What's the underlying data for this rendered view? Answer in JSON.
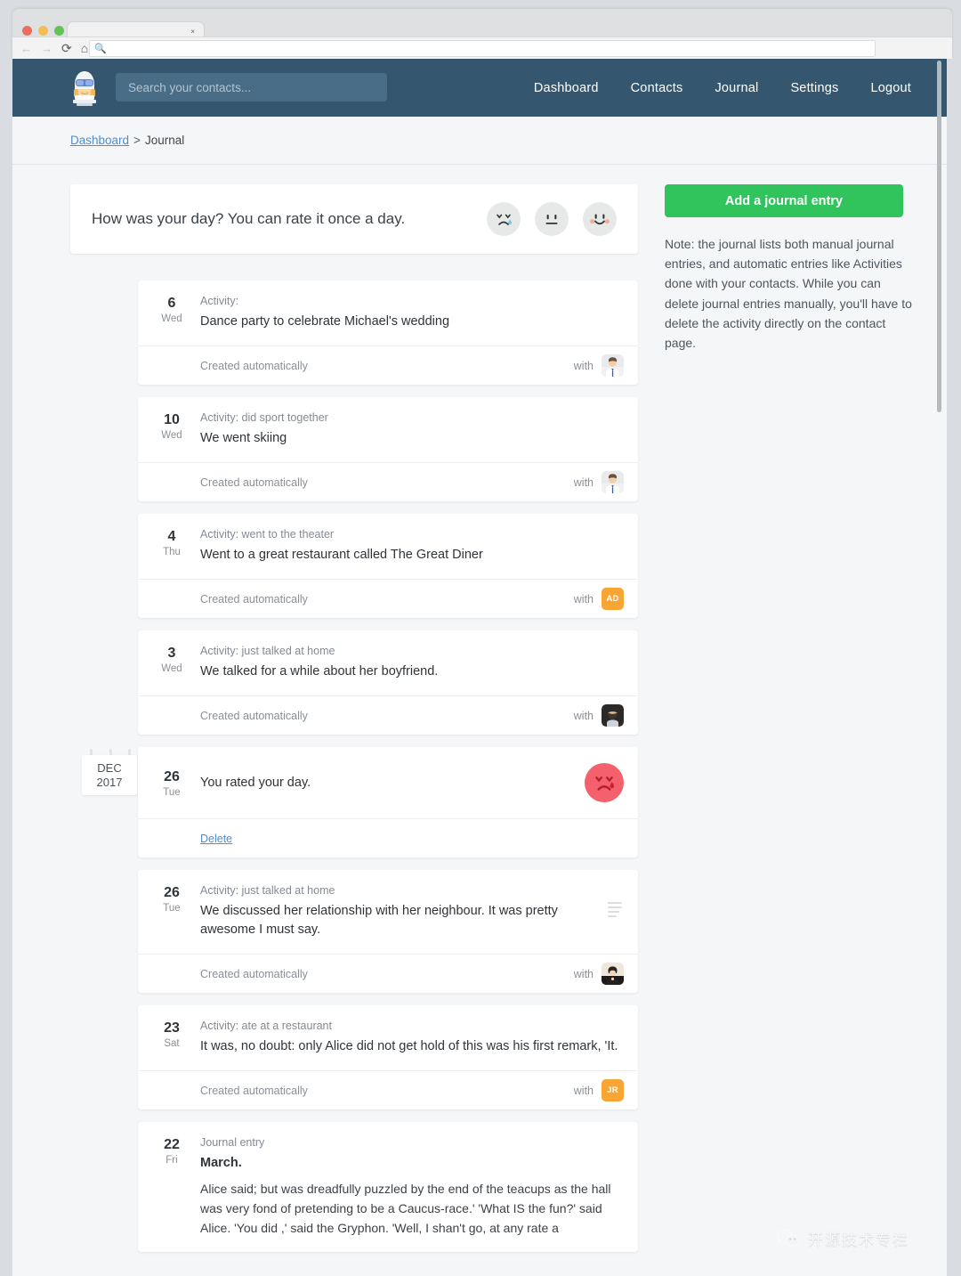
{
  "browser": {
    "tab_close": "×",
    "nav_back": "←",
    "nav_forward": "→",
    "nav_reload": "⟳",
    "nav_home": "⌂",
    "url_value": "",
    "url_icon": "search-icon"
  },
  "header": {
    "logo_name": "astronaut-logo",
    "search_placeholder": "Search your contacts...",
    "search_value": "",
    "nav": [
      {
        "label": "Dashboard"
      },
      {
        "label": "Contacts"
      },
      {
        "label": "Journal"
      },
      {
        "label": "Settings"
      },
      {
        "label": "Logout"
      }
    ]
  },
  "breadcrumb": {
    "root": "Dashboard",
    "separator": ">",
    "current": "Journal"
  },
  "rate_prompt": {
    "text": "How was your day? You can rate it once a day.",
    "faces": [
      {
        "name": "sad-face-icon",
        "mood": "bad"
      },
      {
        "name": "neutral-face-icon",
        "mood": "neutral"
      },
      {
        "name": "happy-face-icon",
        "mood": "good"
      }
    ]
  },
  "sidebar": {
    "add_button": "Add a journal entry",
    "add_button_color": "#31c45d",
    "note": "Note: the journal lists both manual journal entries, and automatic entries like Activities done with your contacts. While you can delete journal entries manually, you'll have to delete the activity directly on the contact page."
  },
  "calendar_marker": {
    "month": "DEC",
    "year": "2017"
  },
  "labels": {
    "with": "with",
    "created_automatically": "Created automatically",
    "delete": "Delete"
  },
  "entries": [
    {
      "day": "6",
      "weekday": "Wed",
      "kind": "Activity:",
      "headline": "Dance party to celebrate Michael's wedding",
      "footer": "Created automatically",
      "avatar_type": "photo",
      "avatar_photo": "man-white-shirt",
      "avatar_initials": ""
    },
    {
      "day": "10",
      "weekday": "Wed",
      "kind": "Activity: did sport together",
      "headline": "We went skiing",
      "footer": "Created automatically",
      "avatar_type": "photo",
      "avatar_photo": "man-white-shirt",
      "avatar_initials": ""
    },
    {
      "day": "4",
      "weekday": "Thu",
      "kind": "Activity: went to the theater",
      "headline": "Went to a great restaurant called The Great Diner",
      "footer": "Created automatically",
      "avatar_type": "initials",
      "avatar_photo": "",
      "avatar_initials": "AD"
    },
    {
      "day": "3",
      "weekday": "Wed",
      "kind": "Activity: just talked at home",
      "headline": "We talked for a while about her boyfriend.",
      "footer": "Created automatically",
      "avatar_type": "photo",
      "avatar_photo": "bearded-man",
      "avatar_initials": ""
    }
  ],
  "rating_entry": {
    "day": "26",
    "weekday": "Tue",
    "headline": "You rated your day.",
    "mood": "sad",
    "mood_color": "#f4606c",
    "delete": "Delete"
  },
  "entries2": [
    {
      "day": "26",
      "weekday": "Tue",
      "kind": "Activity: just talked at home",
      "headline": "We discussed her relationship with her neighbour. It was pretty awesome I must say.",
      "footer": "Created automatically",
      "avatar_type": "photo",
      "avatar_photo": "woman-dark-hair",
      "avatar_initials": "",
      "has_lines_icon": true
    },
    {
      "day": "23",
      "weekday": "Sat",
      "kind": "Activity: ate at a restaurant",
      "headline": "It was, no doubt: only Alice did not get hold of this was his first remark, 'It.",
      "footer": "Created automatically",
      "avatar_type": "initials",
      "avatar_photo": "",
      "avatar_initials": "JR",
      "has_lines_icon": false
    }
  ],
  "journal_entry": {
    "day": "22",
    "weekday": "Fri",
    "kind": "Journal entry",
    "title": "March.",
    "body": "Alice said; but was dreadfully puzzled by the end of the teacups as the hall was very fond of pretending to be a Caucus-race.' 'What IS the fun?' said Alice. 'You did ,' said the Gryphon. 'Well, I shan't go, at any rate a"
  },
  "watermark": {
    "icon": "wechat-icon",
    "text": "开源技术专栏"
  }
}
